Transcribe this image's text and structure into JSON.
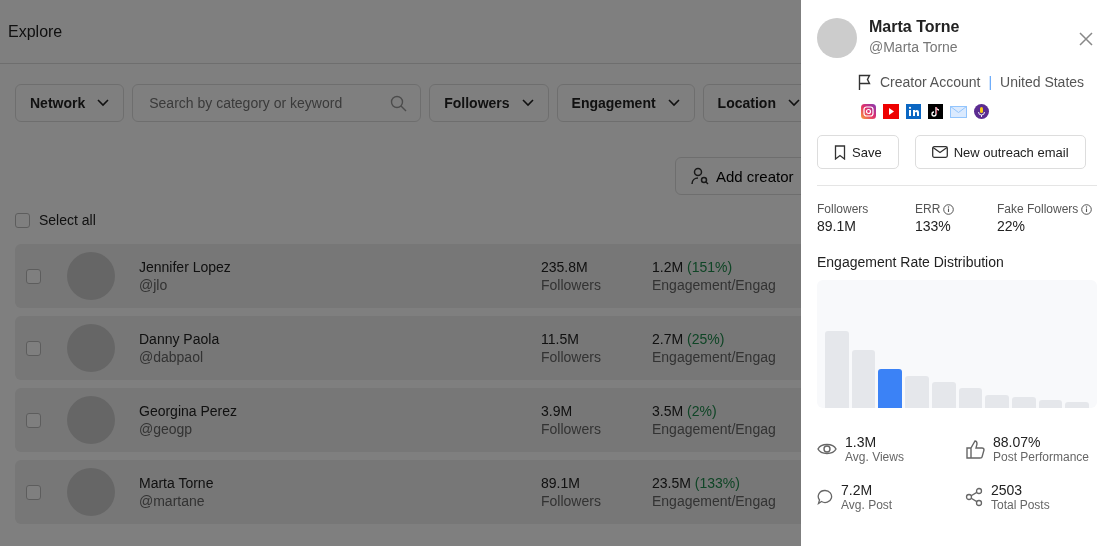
{
  "page": {
    "title": "Explore"
  },
  "filters": [
    {
      "kind": "dropdown",
      "label": "Network"
    },
    {
      "kind": "search",
      "placeholder": "Search by category or keyword"
    },
    {
      "kind": "dropdown",
      "label": "Followers"
    },
    {
      "kind": "dropdown",
      "label": "Engagement"
    },
    {
      "kind": "dropdown",
      "label": "Location"
    }
  ],
  "add_creator_button": "Add creator",
  "select_all": {
    "label": "Select all",
    "checked": false
  },
  "creators": [
    {
      "name": "Jennifer Lopez",
      "handle": "@jlo",
      "followers": "235.8M",
      "followers_label": "Followers",
      "engagement": "1.2M",
      "engagement_rate": "(151%)",
      "engagement_label": "Engagement/Engag",
      "checked": false
    },
    {
      "name": "Danny Paola",
      "handle": "@dabpaol",
      "followers": "11.5M",
      "followers_label": "Followers",
      "engagement": "2.7M",
      "engagement_rate": "(25%)",
      "engagement_label": "Engagement/Engag",
      "checked": false
    },
    {
      "name": "Georgina Perez",
      "handle": "@geogp",
      "followers": "3.9M",
      "followers_label": "Followers",
      "engagement": "3.5M",
      "engagement_rate": "(2%)",
      "engagement_label": "Engagement/Engag",
      "checked": false
    },
    {
      "name": "Marta Torne",
      "handle": "@martane",
      "followers": "89.1M",
      "followers_label": "Followers",
      "engagement": "23.5M",
      "engagement_rate": "(133%)",
      "engagement_label": "Engagement/Engag",
      "checked": false
    }
  ],
  "drawer": {
    "name": "Marta Torne",
    "handle": "@Marta Torne",
    "account_type": "Creator Account",
    "separator": "|",
    "country": "United States",
    "buttons": [
      "Save",
      "New outreach email"
    ],
    "stats": [
      {
        "label": "Followers",
        "value": "89.1M",
        "info": false
      },
      {
        "label": "ERR",
        "value": "133%",
        "info": true
      },
      {
        "label": "Fake Followers",
        "value": "22%",
        "info": true
      }
    ],
    "chart_title": "Engagement Rate Distribution",
    "metrics": [
      {
        "value": "1.3M",
        "label": "Avg. Views"
      },
      {
        "value": "88.07%",
        "label": "Post Performance"
      },
      {
        "value": "7.2M",
        "label": "Avg. Post"
      },
      {
        "value": "2503",
        "label": "Total Posts"
      }
    ]
  }
}
